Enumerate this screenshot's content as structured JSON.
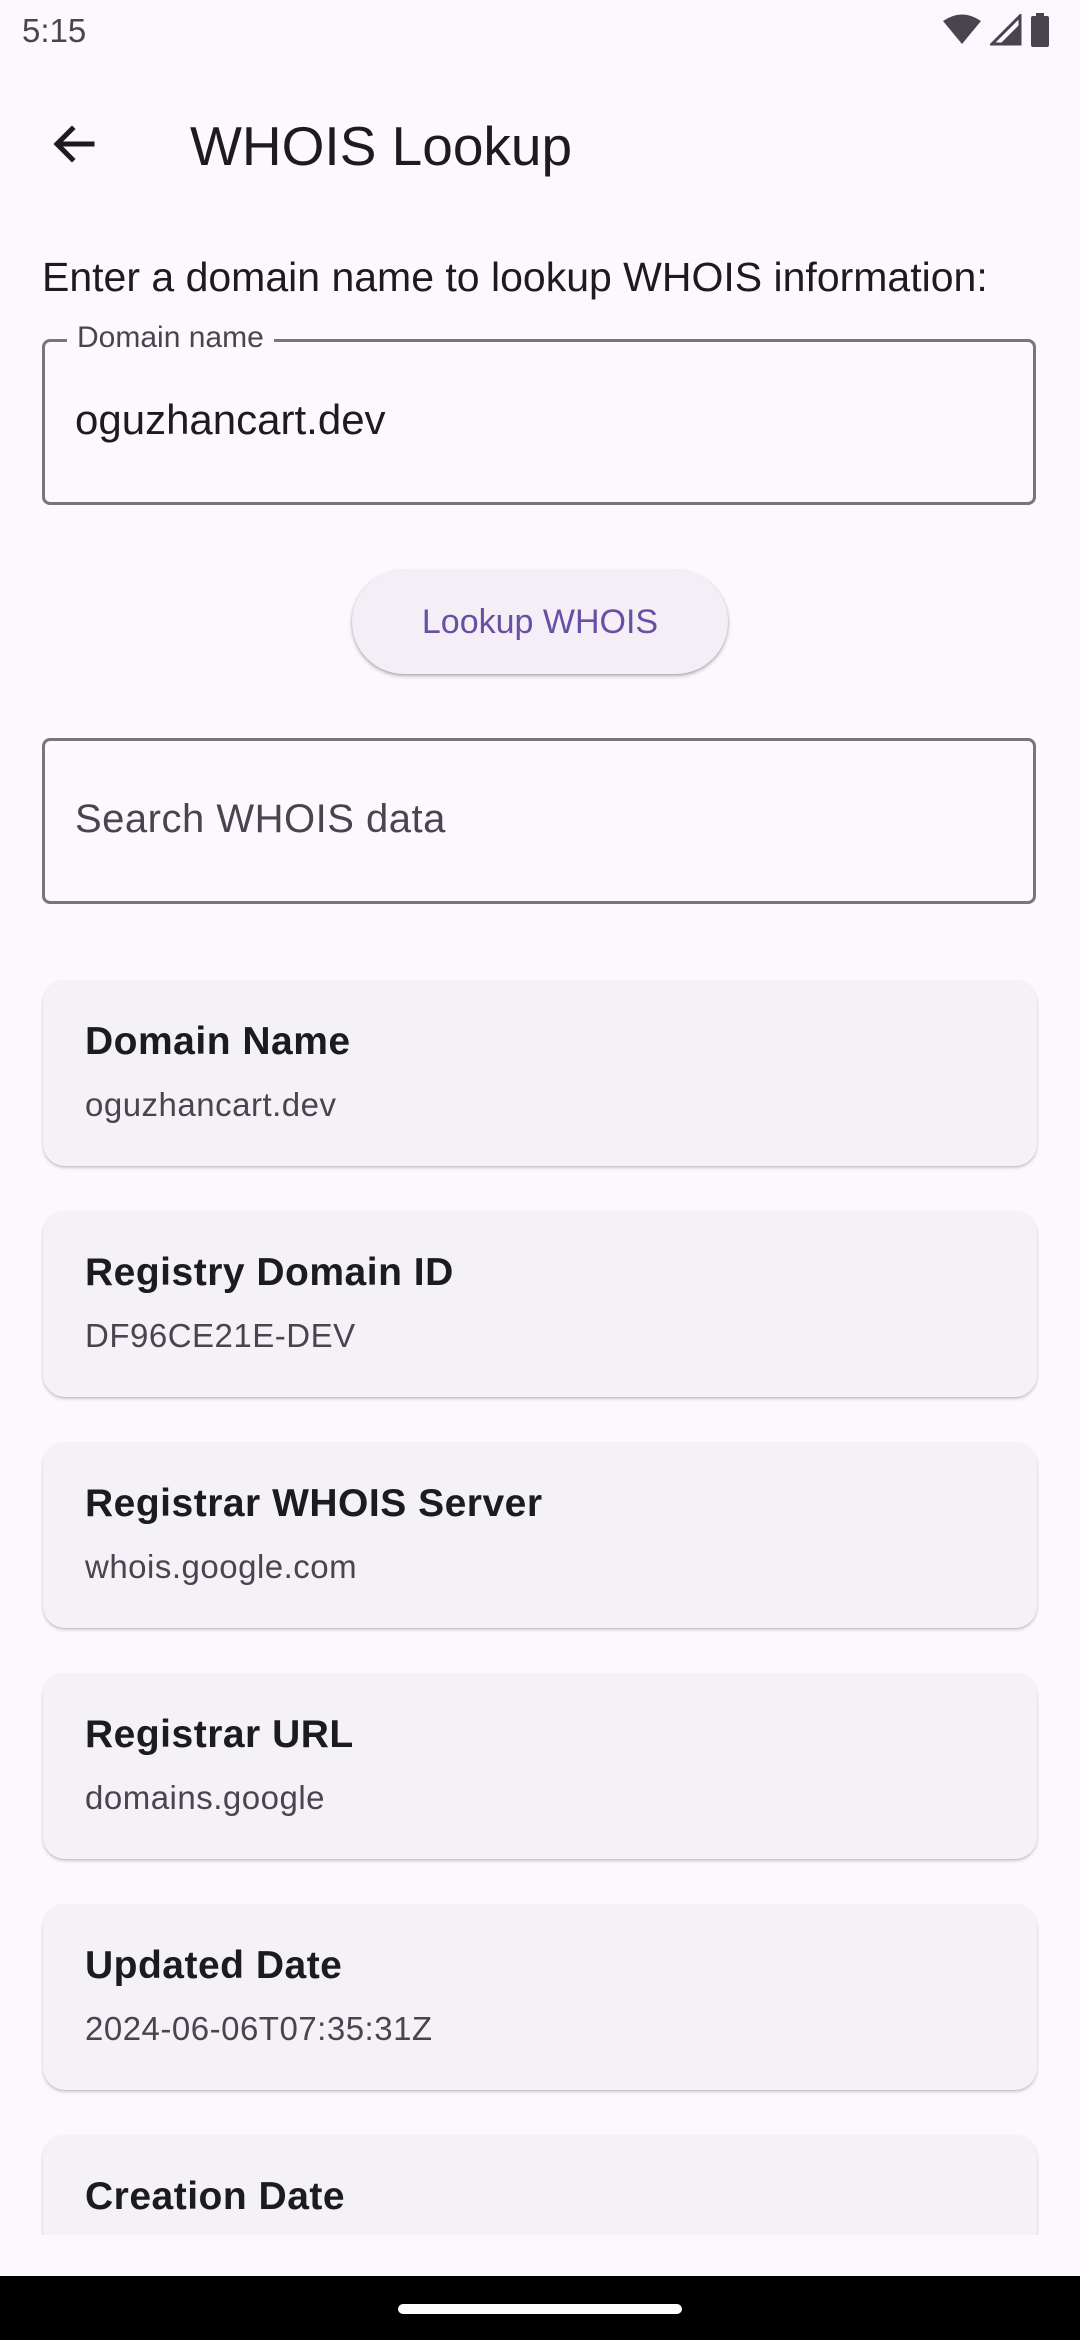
{
  "status_bar": {
    "time": "5:15"
  },
  "app_bar": {
    "back_icon": "arrow-back-icon",
    "title": "WHOIS Lookup"
  },
  "form": {
    "instructions": "Enter a domain name to lookup WHOIS information:",
    "domain_label": "Domain name",
    "domain_value": "oguzhancart.dev",
    "lookup_button_label": "Lookup WHOIS",
    "search_placeholder": "Search WHOIS data"
  },
  "results": [
    {
      "label": "Domain Name",
      "value": "oguzhancart.dev"
    },
    {
      "label": "Registry Domain ID",
      "value": "DF96CE21E-DEV"
    },
    {
      "label": "Registrar WHOIS Server",
      "value": "whois.google.com"
    },
    {
      "label": "Registrar URL",
      "value": "domains.google"
    },
    {
      "label": "Updated Date",
      "value": "2024-06-06T07:35:31Z"
    },
    {
      "label": "Creation Date",
      "value": ""
    }
  ],
  "colors": {
    "background": "#fdf8fd",
    "accent": "#6750a4",
    "card": "#f4f1f7",
    "outline": "#79747e"
  }
}
